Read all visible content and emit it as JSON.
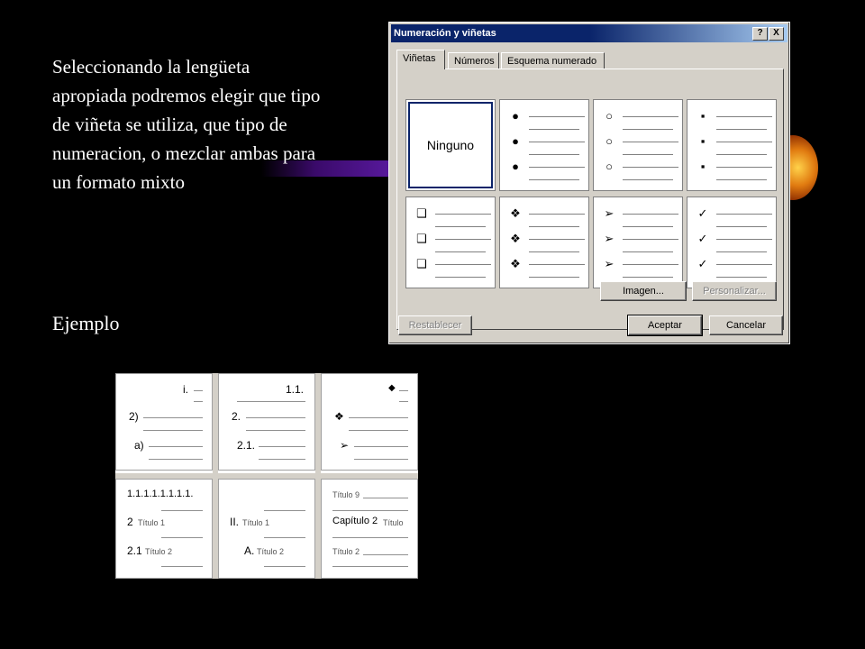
{
  "slide": {
    "paragraph": "Seleccionando la lengüeta apropiada podremos elegir que tipo de viñeta se utiliza, que tipo de numeracion, o mezclar ambas para un formato mixto",
    "ejemplo": "Ejemplo"
  },
  "dialog": {
    "title": "Numeración y viñetas",
    "help_btn": "?",
    "close_btn": "X",
    "tabs": [
      "Viñetas",
      "Números",
      "Esquema numerado"
    ],
    "none_label": "Ninguno",
    "bullets": [
      "●",
      "○",
      "▪",
      "❑",
      "❖",
      "➢",
      "✓"
    ],
    "buttons": {
      "imagen": "Imagen...",
      "personalizar": "Personalizar...",
      "restablecer": "Restablecer",
      "aceptar": "Aceptar",
      "cancelar": "Cancelar"
    }
  },
  "example": {
    "c1": {
      "a": "i.",
      "b": "2)",
      "c": "a)"
    },
    "c2": {
      "a": "1.1.",
      "b": "2.",
      "c": "2.1."
    },
    "c3": {
      "a": "◆",
      "b": "❖",
      "c": "➢"
    },
    "c4": {
      "a": "1.1.1.1.1.1.1.1.",
      "b": "2",
      "b2": "Título 1",
      "c": "2.1",
      "c2": "Título 2"
    },
    "c5": {
      "b": "II.",
      "b2": "Título 1",
      "c": "A.",
      "c2": "Título 2"
    },
    "c6": {
      "a": "Título 9",
      "b": "Capítulo 2",
      "b2": "Título",
      "c": "Título 2"
    }
  }
}
